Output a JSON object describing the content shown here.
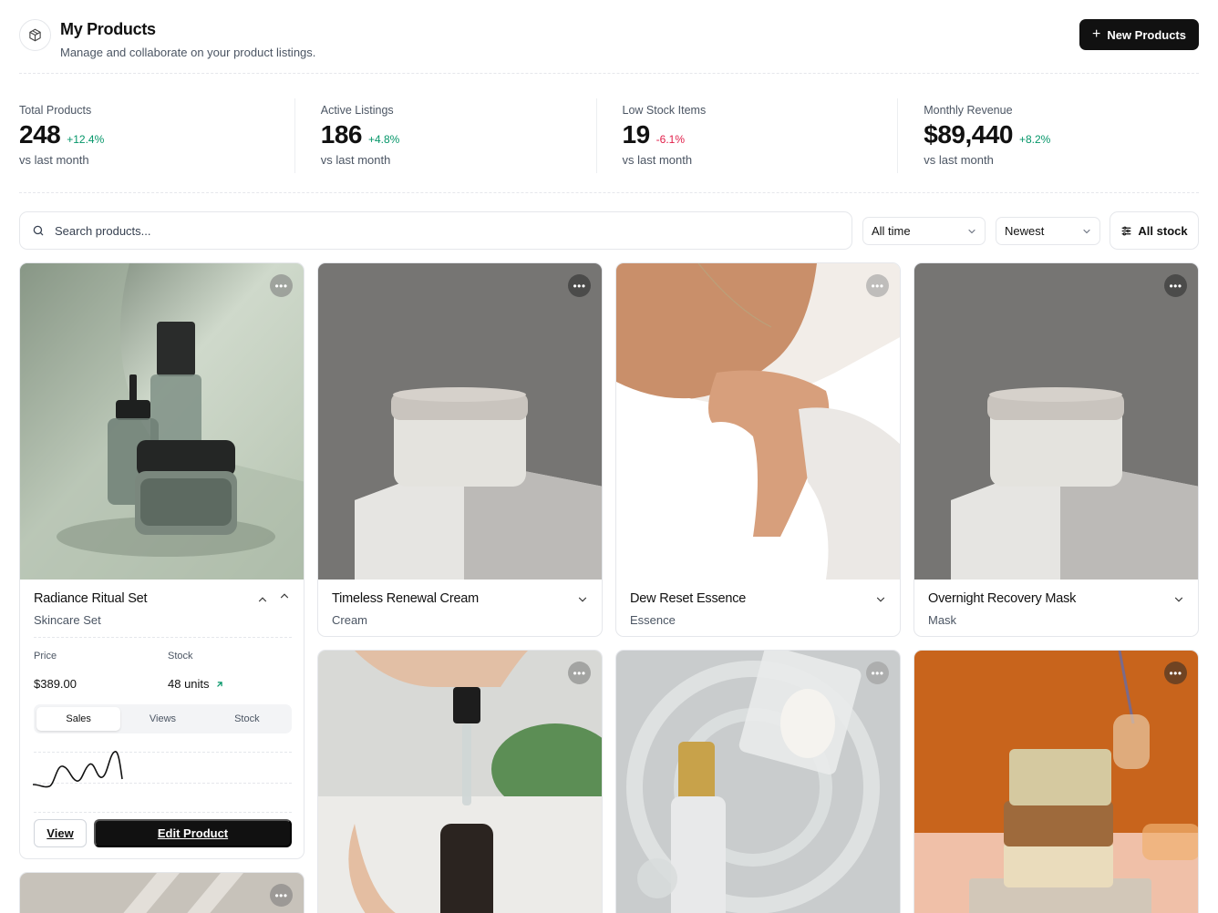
{
  "header": {
    "title": "My Products",
    "subtitle": "Manage and collaborate on your product listings.",
    "new_button": "New Products",
    "logo_icon": "package-icon"
  },
  "stats": [
    {
      "label": "Total Products",
      "value": "248",
      "change": "+12.4%",
      "trend": "up",
      "foot": "vs last month"
    },
    {
      "label": "Active Listings",
      "value": "186",
      "change": "+4.8%",
      "trend": "up",
      "foot": "vs last month"
    },
    {
      "label": "Low Stock Items",
      "value": "19",
      "change": "-6.1%",
      "trend": "down",
      "foot": "vs last month"
    },
    {
      "label": "Monthly Revenue",
      "value": "$89,440",
      "change": "+8.2%",
      "trend": "up",
      "foot": "vs last month"
    }
  ],
  "filters": {
    "search_placeholder": "Search products...",
    "time": "All time",
    "sort": "Newest",
    "stock": "All stock"
  },
  "products": [
    {
      "name": "Radiance Ritual Set",
      "category": "Skincare Set",
      "expanded": true,
      "price_label": "Price",
      "price": "$389.00",
      "stock_label": "Stock",
      "stock": "48 units",
      "tabs": [
        "Sales",
        "Views",
        "Stock"
      ],
      "active_tab": "Sales",
      "view_label": "View",
      "edit_label": "Edit Product"
    },
    {
      "name": "Timeless Renewal Cream",
      "category": "Cream"
    },
    {
      "name": "Dew Reset Essence",
      "category": "Essence"
    },
    {
      "name": "Overnight Recovery Mask",
      "category": "Mask"
    }
  ],
  "colors": {
    "positive": "#059669",
    "negative": "#e11d48",
    "primary": "#111111"
  }
}
